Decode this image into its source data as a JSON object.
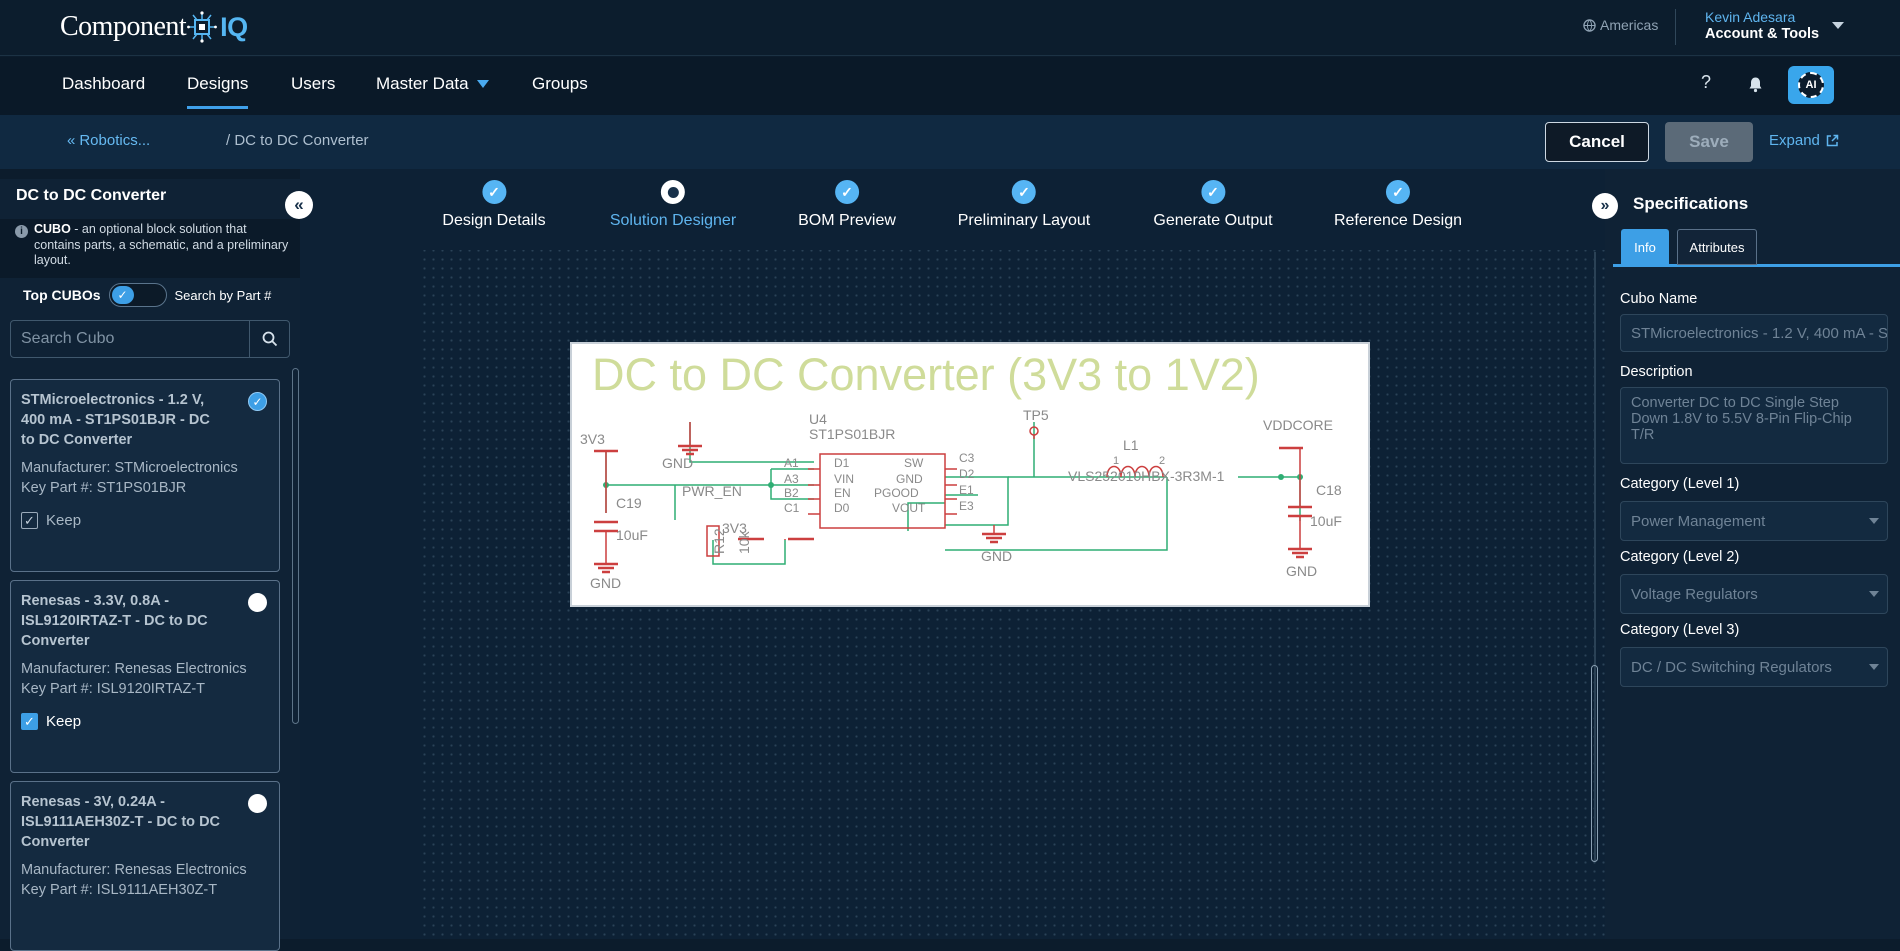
{
  "app": {
    "logo_text": "Component",
    "logo_iq": "IQ",
    "region": "Americas",
    "user_name": "Kevin Adesara",
    "account_label": "Account & Tools"
  },
  "nav": {
    "items": [
      {
        "label": "Dashboard"
      },
      {
        "label": "Designs"
      },
      {
        "label": "Users"
      },
      {
        "label": "Master Data"
      },
      {
        "label": "Groups"
      }
    ],
    "active": "Designs",
    "help_icon": "?",
    "ai_label": "AI"
  },
  "subbar": {
    "breadcrumb_back": "Robotics...",
    "breadcrumb_current": "/ DC to DC Converter",
    "cancel_label": "Cancel",
    "save_label": "Save",
    "expand_label": "Expand"
  },
  "sidebar": {
    "title": "DC to DC Converter",
    "info_bold": "CUBO",
    "info_text": " - an optional block solution that contains parts, a schematic, and a preliminary layout.",
    "toggle_left": "Top CUBOs",
    "toggle_right": "Search by Part #",
    "search_placeholder": "Search Cubo",
    "cards": [
      {
        "title": "STMicroelectronics - 1.2 V, 400 mA - ST1PS01BJR - DC to DC Converter",
        "manufacturer": "Manufacturer: STMicroelectronics",
        "key_part": "Key Part #: ST1PS01BJR",
        "keep_label": "Keep",
        "selected": true,
        "keep": false
      },
      {
        "title": "Renesas - 3.3V, 0.8A - ISL9120IRTAZ-T - DC to DC Converter",
        "manufacturer": "Manufacturer: Renesas Electronics",
        "key_part": "Key Part #: ISL9120IRTAZ-T",
        "keep_label": "Keep",
        "selected": false,
        "keep": true
      },
      {
        "title": "Renesas - 3V, 0.24A - ISL9111AEH30Z-T - DC to DC Converter",
        "manufacturer": "Manufacturer: Renesas Electronics",
        "key_part": "Key Part #: ISL9111AEH30Z-T",
        "selected": false
      }
    ]
  },
  "steps": [
    {
      "label": "Design Details",
      "state": "done"
    },
    {
      "label": "Solution Designer",
      "state": "current"
    },
    {
      "label": "BOM Preview",
      "state": "done"
    },
    {
      "label": "Preliminary Layout",
      "state": "done"
    },
    {
      "label": "Generate Output",
      "state": "done"
    },
    {
      "label": "Reference Design",
      "state": "done"
    }
  ],
  "schematic": {
    "title": "DC to DC Converter (3V3 to 1V2)",
    "labels": {
      "v3v3_a": "3V3",
      "gnd_a": "GND",
      "gnd_b": "GND",
      "c19": "C19",
      "c19_val": "10uF",
      "pwr_en": "PWR_EN",
      "r12": "R12",
      "r12_val": "10k",
      "v3v3_b": "3V3",
      "u4": "U4",
      "u4_part": "ST1PS01BJR",
      "pin_a1": "A1",
      "pin_a3": "A3",
      "pin_b2": "B2",
      "pin_c1": "C1",
      "pin_d1": "D1",
      "pin_vin": "VIN",
      "pin_en": "EN",
      "pin_d0": "D0",
      "pin_sw": "SW",
      "pin_gnd": "GND",
      "pin_pgood": "PGOOD",
      "pin_vout": "VOUT",
      "pin_c3": "C3",
      "pin_d2": "D2",
      "pin_e1": "E1",
      "pin_e3": "E3",
      "gnd_c": "GND",
      "tp5": "TP5",
      "l1": "L1",
      "l1_p1": "1",
      "l1_p2": "2",
      "l1_part": "VLS252010HBX-3R3M-1",
      "vddcore": "VDDCORE",
      "c18": "C18",
      "c18_val": "10uF",
      "gnd_d": "GND"
    }
  },
  "specs": {
    "title": "Specifications",
    "tab_info": "Info",
    "tab_attributes": "Attributes",
    "cubo_name_label": "Cubo Name",
    "cubo_name_value": "STMicroelectronics - 1.2 V, 400 mA - ST1PS01BJR - DC to DC Converter",
    "description_label": "Description",
    "description_value": "Converter DC to DC Single Step Down 1.8V to 5.5V 8-Pin Flip-Chip T/R",
    "cat1_label": "Category (Level 1)",
    "cat1_value": "Power Management",
    "cat2_label": "Category (Level 2)",
    "cat2_value": "Voltage Regulators",
    "cat3_label": "Category (Level 3)",
    "cat3_value": "DC / DC Switching Regulators"
  },
  "colors": {
    "accent": "#3d9fe6",
    "schematic_red": "#cc3f3f",
    "schematic_green": "#2fae74",
    "schematic_text": "#8a8a8a",
    "schematic_title": "#cfdc9a"
  },
  "icons": {
    "globe": "globe-icon",
    "bell": "bell-icon",
    "search": "search-icon",
    "external": "external-link-icon",
    "collapse": "double-chevron-icon"
  }
}
